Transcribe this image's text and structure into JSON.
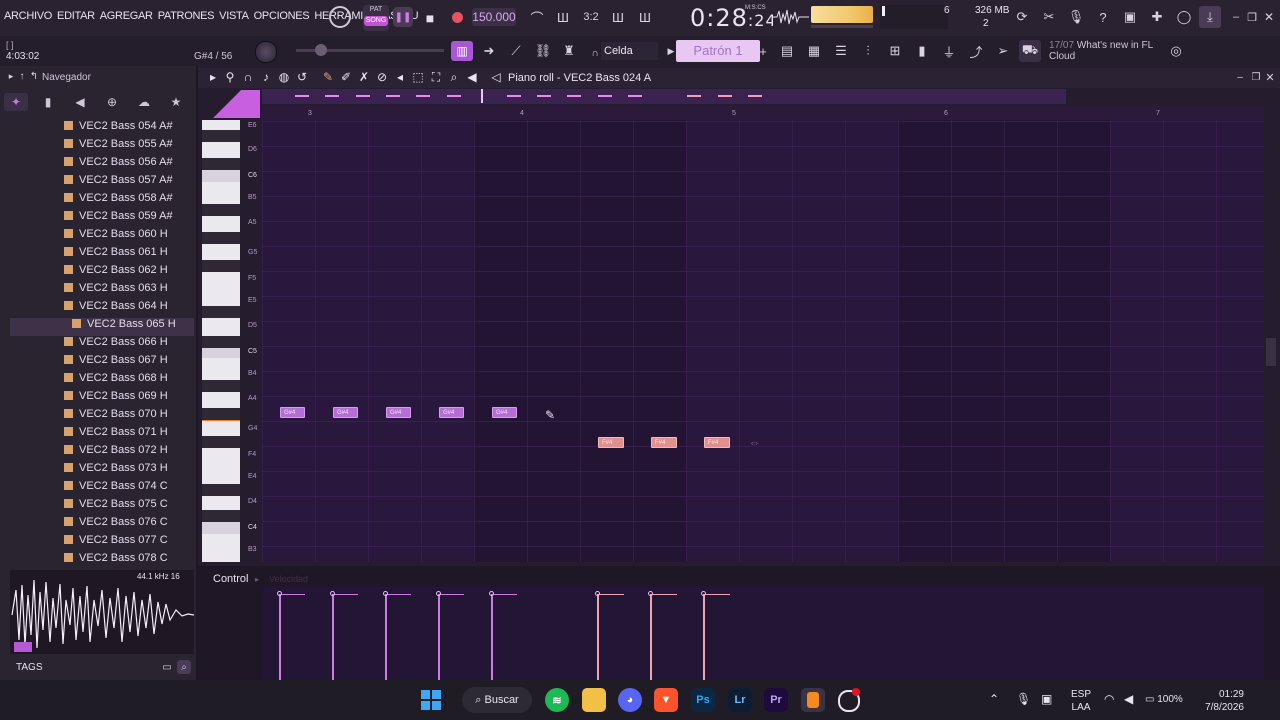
{
  "menu": [
    "ARCHIVO",
    "EDITAR",
    "AGREGAR",
    "PATRONES",
    "VISTA",
    "OPCIONES",
    "HERRAMIENTAS",
    "AYU"
  ],
  "transport": {
    "pat": "PAT",
    "song": "SONG",
    "tempo": "150.000",
    "time_main": "0:28",
    "time_small": ":24",
    "time_unit": "M:S:CS"
  },
  "monitor": {
    "cpu": "6",
    "memory": "326 MB",
    "polyphony": "2"
  },
  "row2": {
    "hint_line1": "[ ]",
    "hint_line2": "4:03:02",
    "note_info": "G#4 / 56",
    "snap": "Celda",
    "pattern": "Patrón 1",
    "news_date": "17/07",
    "news_title": "What's new in FL",
    "news_title2": "Cloud"
  },
  "browser": {
    "header": "Navegador",
    "items": [
      "VEC2 Bass 054 A#",
      "VEC2 Bass 055 A#",
      "VEC2 Bass 056 A#",
      "VEC2 Bass 057 A#",
      "VEC2 Bass 058 A#",
      "VEC2 Bass 059 A#",
      "VEC2 Bass 060 H",
      "VEC2 Bass 061 H",
      "VEC2 Bass 062 H",
      "VEC2 Bass 063 H",
      "VEC2 Bass 064 H",
      "VEC2 Bass 065 H",
      "VEC2 Bass 066 H",
      "VEC2 Bass 067 H",
      "VEC2 Bass 068 H",
      "VEC2 Bass 069 H",
      "VEC2 Bass 070 H",
      "VEC2 Bass 071 H",
      "VEC2 Bass 072 H",
      "VEC2 Bass 073 H",
      "VEC2 Bass 074 C",
      "VEC2 Bass 075 C",
      "VEC2 Bass 076 C",
      "VEC2 Bass 077 C",
      "VEC2 Bass 078 C"
    ],
    "selected_index": 11,
    "wave_info": "44.1 kHz 16",
    "tags": "TAGS"
  },
  "piano_roll": {
    "title": "Piano roll - VEC2 Bass 024 A",
    "bar_numbers": [
      "3",
      "4",
      "5",
      "6",
      "7"
    ],
    "key_labels": [
      "E6",
      "D6",
      "C6",
      "B5",
      "A5",
      "G5",
      "F5",
      "E5",
      "D5",
      "C5",
      "B4",
      "A4",
      "G4",
      "F4",
      "E4",
      "D4",
      "C4",
      "B3"
    ],
    "notes_a": [
      "G#4",
      "G#4",
      "G#4",
      "G#4",
      "G#4"
    ],
    "notes_b": [
      "F#4",
      "F#4",
      "F#4"
    ],
    "control_label": "Control",
    "control_param": "Velocidad"
  },
  "taskbar": {
    "search": "Buscar",
    "lang1": "ESP",
    "lang2": "LAA",
    "battery": "100%",
    "time": "01:29",
    "date": "7/8/2026",
    "apps": [
      "Ps",
      "Lr",
      "Pr"
    ]
  }
}
